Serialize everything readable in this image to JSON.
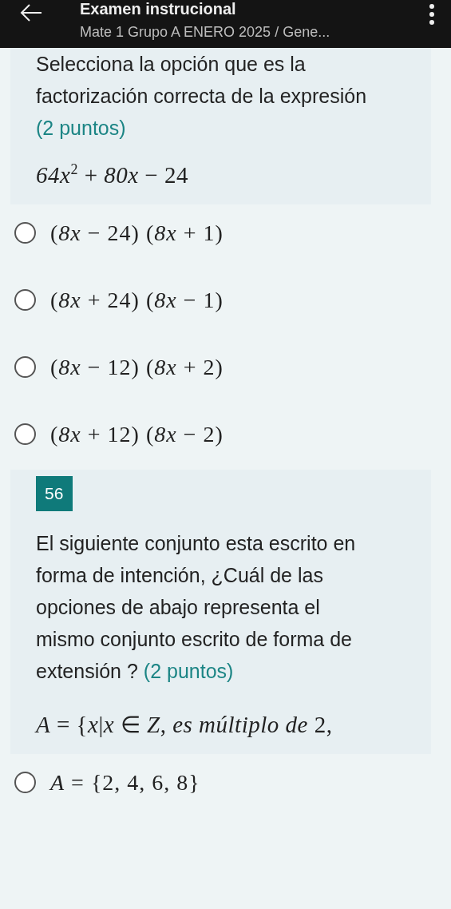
{
  "app_bar": {
    "title": "Examen instrucional",
    "subtitle": "Mate 1 Grupo A ENERO 2025 / Gene..."
  },
  "questions": [
    {
      "text": "Selecciona la opción que es la factorización correcta de la expresión",
      "points": "(2 puntos)",
      "formula": "*64x*$^{2}$ + *80x* − 24",
      "options": [
        {
          "text": "(*8x* − 24) (*8x* + 1)",
          "selected": false
        },
        {
          "text": "(*8x* + 24) (*8x* − 1)",
          "selected": false
        },
        {
          "text": "(*8x* − 12) (*8x* + 2)",
          "selected": false
        },
        {
          "text": "(*8x* + 12) (*8x* − 2)",
          "selected": false
        }
      ]
    },
    {
      "number": "56",
      "text": "El siguiente conjunto esta escrito en forma de intención, ¿Cuál de las opciones de abajo representa el mismo conjunto escrito de forma de extensión ?",
      "points": "(2 puntos)",
      "formula": "*A* = {*x*|*x*  ∈  *Z*,  *es múltiplo de* 2,",
      "options": [
        {
          "text": "*A* = {2, 4, 6, 8}",
          "selected": false
        }
      ]
    }
  ]
}
